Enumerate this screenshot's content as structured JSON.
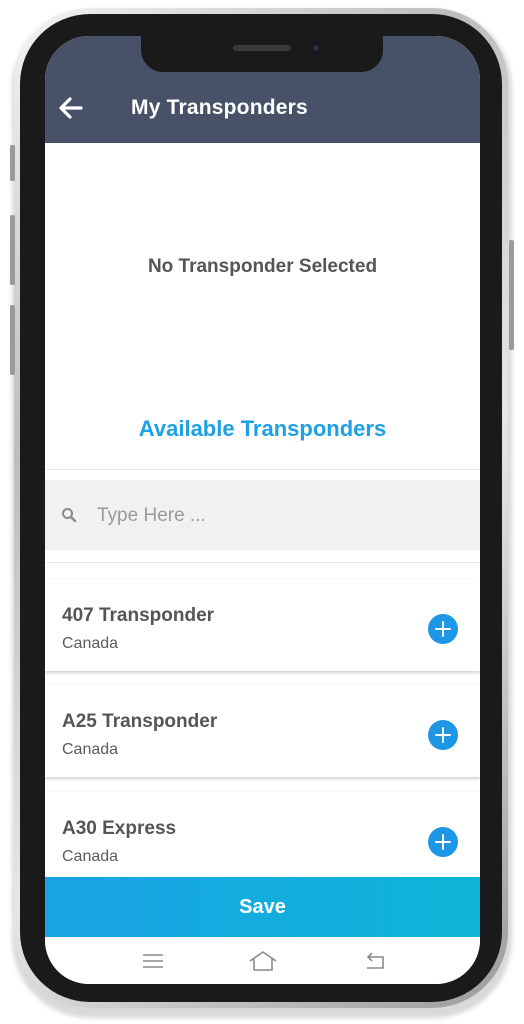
{
  "appbar": {
    "title": "My Transponders",
    "back_icon": "arrow-left-icon",
    "color": "#475269"
  },
  "selected": {
    "empty_text": "No Transponder Selected"
  },
  "available": {
    "title": "Available Transponders",
    "title_color": "#1ea0e6"
  },
  "search": {
    "icon": "search-icon",
    "placeholder": "Type Here ..."
  },
  "transponders": [
    {
      "name": "407 Transponder",
      "country": "Canada",
      "action_icon": "plus-circle-icon"
    },
    {
      "name": "A25 Transponder",
      "country": "Canada",
      "action_icon": "plus-circle-icon"
    },
    {
      "name": "A30 Express",
      "country": "Canada",
      "action_icon": "plus-circle-icon"
    }
  ],
  "footer": {
    "save_label": "Save",
    "accent_color": "#1aa3e6"
  },
  "system_nav": {
    "icons": [
      "menu-icon",
      "home-icon",
      "back-nav-icon"
    ]
  }
}
